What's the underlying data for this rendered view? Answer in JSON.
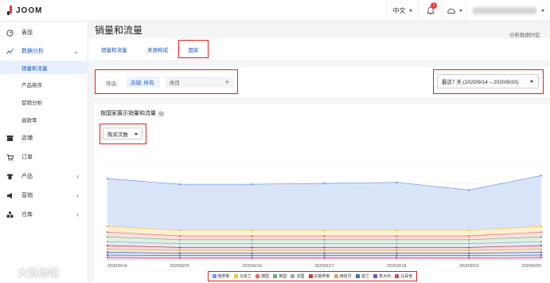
{
  "header": {
    "logo_text": "JOOM",
    "language": "中文",
    "notification_count": "1"
  },
  "sidebar": {
    "items": [
      {
        "label": "表现",
        "icon": "gauge-icon"
      },
      {
        "label": "数据分析",
        "icon": "analytics-icon",
        "expanded": true
      },
      {
        "label": "店铺",
        "icon": "store-icon"
      },
      {
        "label": "订单",
        "icon": "cart-icon"
      },
      {
        "label": "产品",
        "icon": "shirt-icon"
      },
      {
        "label": "营销",
        "icon": "megaphone-icon"
      },
      {
        "label": "仓库",
        "icon": "warehouse-icon"
      }
    ],
    "sub_items": [
      "销量和流量",
      "产品排序",
      "促销分析",
      "退款率"
    ]
  },
  "page": {
    "title": "销量和流量",
    "region_link": "分析数据时区"
  },
  "tabs": [
    "销量和流量",
    "来源构成",
    "国家"
  ],
  "filter": {
    "label": "筛选:",
    "store_chip": "店铺: 所有",
    "category_placeholder": "类目",
    "date_range": "最近7 天 (2020/9/14 – 2020/9/20)"
  },
  "chart_card": {
    "title": "按国家展示销量和流量",
    "metric": "购买次数"
  },
  "chart_data": {
    "type": "area",
    "x": [
      "2020/9/14",
      "2020/9/15",
      "2020/9/16",
      "2020/9/17",
      "2020/9/18",
      "2020/9/19",
      "2020/9/20"
    ],
    "stacked": true,
    "grid": true,
    "legend_position": "bottom",
    "series": [
      {
        "name": "俄罗斯",
        "color": "#6f95e6",
        "fill": "#dae4f9",
        "values": [
          0.85,
          0.79,
          0.79,
          0.8,
          0.81,
          0.73,
          0.88
        ]
      },
      {
        "name": "乌克兰",
        "color": "#f3c243",
        "fill": "#fdf0cf",
        "values": [
          0.35,
          0.31,
          0.31,
          0.31,
          0.31,
          0.31,
          0.35
        ]
      },
      {
        "name": "德国",
        "color": "#ea6b6b",
        "fill": "#fbdede",
        "values": [
          0.29,
          0.25,
          0.25,
          0.25,
          0.25,
          0.25,
          0.29
        ]
      },
      {
        "name": "英国",
        "color": "#5cb87a",
        "fill": "#dcf1e3",
        "values": [
          0.24,
          0.21,
          0.21,
          0.21,
          0.21,
          0.21,
          0.24
        ]
      },
      {
        "name": "法国",
        "color": "#9aa9be",
        "fill": "#e5e9ef",
        "values": [
          0.19,
          0.17,
          0.17,
          0.17,
          0.17,
          0.17,
          0.19
        ]
      },
      {
        "name": "白俄罗斯",
        "color": "#b14545",
        "fill": "#f0dada",
        "values": [
          0.15,
          0.13,
          0.13,
          0.13,
          0.13,
          0.13,
          0.15
        ]
      },
      {
        "name": "西班牙",
        "color": "#e8a05a",
        "fill": "#faead9",
        "values": [
          0.11,
          0.1,
          0.1,
          0.1,
          0.1,
          0.1,
          0.11
        ]
      },
      {
        "name": "波兰",
        "color": "#3f6fb4",
        "fill": "#d8e2f0",
        "values": [
          0.08,
          0.07,
          0.07,
          0.07,
          0.07,
          0.07,
          0.08
        ]
      },
      {
        "name": "意大利",
        "color": "#6e5bb8",
        "fill": "#e4e0f3",
        "values": [
          0.05,
          0.045,
          0.045,
          0.045,
          0.045,
          0.045,
          0.05
        ]
      },
      {
        "name": "马耳他",
        "color": "#c44a6a",
        "fill": "#f4dbe2",
        "values": [
          0.025,
          0.02,
          0.02,
          0.02,
          0.02,
          0.02,
          0.025
        ]
      }
    ]
  },
  "watermark": "大数跨境"
}
